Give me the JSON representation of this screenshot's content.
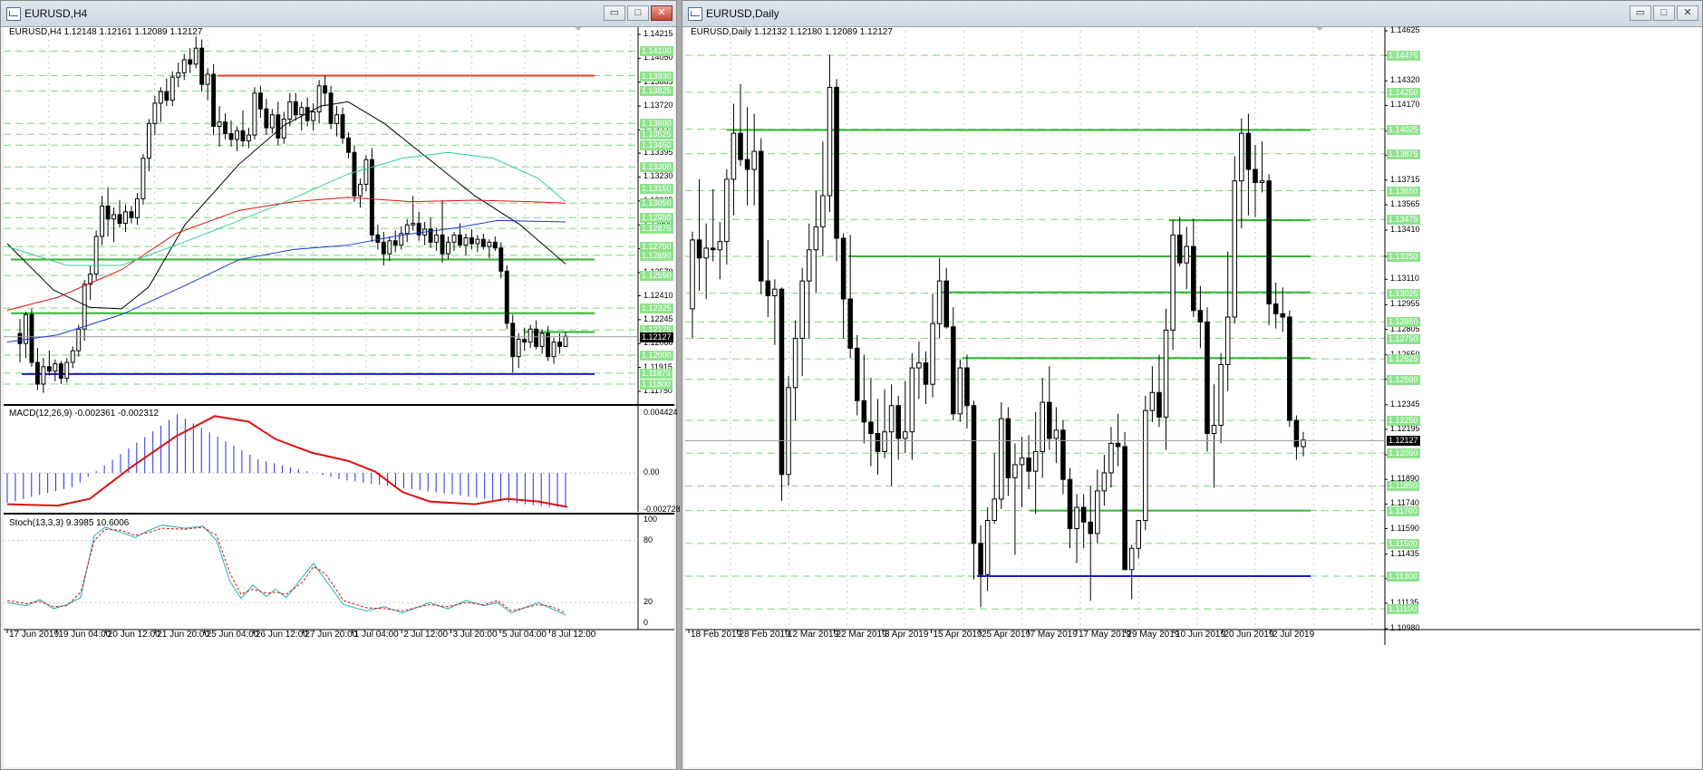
{
  "colors": {
    "bull": "#ffffff",
    "bear": "#000000",
    "support_green": "#2fb52f",
    "resistance_red": "#e8401e",
    "blue_line": "#1a1ad0",
    "grid": "#7ed67e",
    "macd_hist": "#2a2ae0",
    "macd_signal": "#e01010",
    "stoch_main": "#20b0c0",
    "stoch_signal": "#e01010",
    "badge": "#8fe38f",
    "ma_black": "#000000",
    "ma_red": "#e01010",
    "ma_blue": "#1a3ad0",
    "ma_cyan": "#30d090"
  },
  "left": {
    "title": "EURUSD,H4",
    "ohlc": "EURUSD,H4  1.12148 1.12161 1.12089 1.12127",
    "macd_label": "MACD(12,26,9) -0.002361 -0.002312",
    "stoch_label": "Stoch(13,3,3) 9.3985 10.6006",
    "price_ticks": [
      "1.14215",
      "1.14050",
      "1.13885",
      "1.13720",
      "1.13555",
      "1.13395",
      "1.13230",
      "1.13065",
      "1.12900",
      "1.12735",
      "1.12570",
      "1.12410",
      "1.12245",
      "1.12080",
      "1.11915",
      "1.11750"
    ],
    "price_badges": [
      "1.14100",
      "1.13930",
      "1.13825",
      "1.13600",
      "1.13525",
      "1.13450",
      "1.13300",
      "1.13150",
      "1.13050",
      "1.12950",
      "1.12875",
      "1.12750",
      "1.12690",
      "1.12550",
      "1.12325",
      "1.12175",
      "1.12000",
      "1.11875",
      "1.11800"
    ],
    "current_price": "1.12127",
    "macd_ticks": [
      "0.004424",
      "0.00",
      "-0.002728"
    ],
    "stoch_ticks": [
      "100",
      "80",
      "20",
      "0"
    ],
    "date_ticks": [
      "17 Jun 2019",
      "19 Jun 04:00",
      "20 Jun 12:00",
      "21 Jun 20:00",
      "25 Jun 04:00",
      "26 Jun 12:00",
      "27 Jun 20:00",
      "1 Jul 04:00",
      "2 Jul 12:00",
      "3 Jul 20:00",
      "5 Jul 04:00",
      "8 Jul 12:00"
    ],
    "candles": [
      [
        1.1215,
        1.1225,
        1.1195,
        1.1208
      ],
      [
        1.1208,
        1.123,
        1.1198,
        1.1228
      ],
      [
        1.1228,
        1.1232,
        1.1192,
        1.1195
      ],
      [
        1.1195,
        1.1205,
        1.1176,
        1.118
      ],
      [
        1.118,
        1.1198,
        1.1174,
        1.1192
      ],
      [
        1.1192,
        1.1203,
        1.1186,
        1.1189
      ],
      [
        1.1189,
        1.1197,
        1.1182,
        1.1194
      ],
      [
        1.1194,
        1.1196,
        1.118,
        1.1184
      ],
      [
        1.1184,
        1.1198,
        1.1181,
        1.1195
      ],
      [
        1.1195,
        1.1206,
        1.1191,
        1.1203
      ],
      [
        1.1203,
        1.1221,
        1.1199,
        1.1218
      ],
      [
        1.1218,
        1.1252,
        1.121,
        1.1249
      ],
      [
        1.1249,
        1.1262,
        1.1238,
        1.1256
      ],
      [
        1.1256,
        1.1286,
        1.1252,
        1.1282
      ],
      [
        1.1282,
        1.131,
        1.1276,
        1.1303
      ],
      [
        1.1303,
        1.1316,
        1.1282,
        1.1294
      ],
      [
        1.1294,
        1.1302,
        1.1278,
        1.1297
      ],
      [
        1.1297,
        1.1307,
        1.1288,
        1.1291
      ],
      [
        1.1291,
        1.1304,
        1.1285,
        1.1299
      ],
      [
        1.1299,
        1.1303,
        1.1291,
        1.1295
      ],
      [
        1.1295,
        1.1312,
        1.129,
        1.1308
      ],
      [
        1.1308,
        1.1339,
        1.1304,
        1.1336
      ],
      [
        1.1336,
        1.1363,
        1.1327,
        1.136
      ],
      [
        1.136,
        1.1379,
        1.1352,
        1.1374
      ],
      [
        1.1374,
        1.1385,
        1.1361,
        1.1382
      ],
      [
        1.1382,
        1.1391,
        1.1372,
        1.1376
      ],
      [
        1.1376,
        1.1396,
        1.1372,
        1.1392
      ],
      [
        1.1392,
        1.1402,
        1.1385,
        1.1395
      ],
      [
        1.1395,
        1.1408,
        1.139,
        1.1404
      ],
      [
        1.1404,
        1.1412,
        1.1395,
        1.1401
      ],
      [
        1.1401,
        1.142,
        1.1398,
        1.1412
      ],
      [
        1.1412,
        1.1418,
        1.1382,
        1.1387
      ],
      [
        1.1387,
        1.1398,
        1.1376,
        1.1394
      ],
      [
        1.1394,
        1.1401,
        1.1352,
        1.1358
      ],
      [
        1.1358,
        1.1372,
        1.1344,
        1.1361
      ],
      [
        1.1361,
        1.1367,
        1.1349,
        1.1353
      ],
      [
        1.1353,
        1.1362,
        1.1344,
        1.1349
      ],
      [
        1.1349,
        1.1358,
        1.1341,
        1.1355
      ],
      [
        1.1355,
        1.1369,
        1.1344,
        1.1348
      ],
      [
        1.1348,
        1.1357,
        1.1343,
        1.1352
      ],
      [
        1.1352,
        1.1385,
        1.1349,
        1.1381
      ],
      [
        1.1381,
        1.1386,
        1.1364,
        1.137
      ],
      [
        1.137,
        1.1377,
        1.1352,
        1.1357
      ],
      [
        1.1357,
        1.137,
        1.1353,
        1.1366
      ],
      [
        1.1366,
        1.1375,
        1.1345,
        1.135
      ],
      [
        1.135,
        1.1368,
        1.1346,
        1.1363
      ],
      [
        1.1363,
        1.1381,
        1.1358,
        1.1375
      ],
      [
        1.1375,
        1.1381,
        1.1362,
        1.1366
      ],
      [
        1.1366,
        1.1375,
        1.1355,
        1.1371
      ],
      [
        1.1371,
        1.1378,
        1.1358,
        1.1362
      ],
      [
        1.1362,
        1.1374,
        1.1355,
        1.1368
      ],
      [
        1.1368,
        1.139,
        1.136,
        1.1386
      ],
      [
        1.1386,
        1.1393,
        1.1372,
        1.1381
      ],
      [
        1.1381,
        1.1386,
        1.1356,
        1.136
      ],
      [
        1.136,
        1.1372,
        1.1351,
        1.1366
      ],
      [
        1.1366,
        1.1371,
        1.1346,
        1.135
      ],
      [
        1.135,
        1.1354,
        1.1336,
        1.134
      ],
      [
        1.134,
        1.1345,
        1.1306,
        1.131
      ],
      [
        1.131,
        1.1322,
        1.1302,
        1.1318
      ],
      [
        1.1318,
        1.1338,
        1.1313,
        1.1335
      ],
      [
        1.1335,
        1.1343,
        1.1278,
        1.1283
      ],
      [
        1.1283,
        1.129,
        1.1273,
        1.1278
      ],
      [
        1.1278,
        1.1285,
        1.1262,
        1.127
      ],
      [
        1.127,
        1.1282,
        1.1265,
        1.1279
      ],
      [
        1.1279,
        1.1286,
        1.1271,
        1.1276
      ],
      [
        1.1276,
        1.1289,
        1.1273,
        1.1284
      ],
      [
        1.1284,
        1.1294,
        1.1278,
        1.129
      ],
      [
        1.129,
        1.131,
        1.1286,
        1.1291
      ],
      [
        1.1291,
        1.1299,
        1.1279,
        1.1283
      ],
      [
        1.1283,
        1.1292,
        1.1276,
        1.1287
      ],
      [
        1.1287,
        1.1295,
        1.1274,
        1.1278
      ],
      [
        1.1278,
        1.1288,
        1.1272,
        1.1283
      ],
      [
        1.1283,
        1.1307,
        1.1264,
        1.127
      ],
      [
        1.127,
        1.1282,
        1.1266,
        1.1278
      ],
      [
        1.1278,
        1.1285,
        1.1272,
        1.1283
      ],
      [
        1.1283,
        1.1291,
        1.1274,
        1.1276
      ],
      [
        1.1276,
        1.1284,
        1.1269,
        1.1281
      ],
      [
        1.1281,
        1.1287,
        1.1273,
        1.1277
      ],
      [
        1.1277,
        1.1283,
        1.1271,
        1.128
      ],
      [
        1.128,
        1.1284,
        1.1273,
        1.1275
      ],
      [
        1.1275,
        1.128,
        1.1267,
        1.1278
      ],
      [
        1.1278,
        1.1282,
        1.1272,
        1.1274
      ],
      [
        1.1274,
        1.1278,
        1.1253,
        1.1258
      ],
      [
        1.1258,
        1.1262,
        1.1218,
        1.1222
      ],
      [
        1.1222,
        1.1228,
        1.1188,
        1.1199
      ],
      [
        1.1199,
        1.1215,
        1.1191,
        1.1211
      ],
      [
        1.1211,
        1.1219,
        1.1203,
        1.1209
      ],
      [
        1.1209,
        1.1221,
        1.1205,
        1.1218
      ],
      [
        1.1218,
        1.1224,
        1.1204,
        1.1206
      ],
      [
        1.1206,
        1.1218,
        1.1201,
        1.1215
      ],
      [
        1.1215,
        1.122,
        1.1196,
        1.1199
      ],
      [
        1.1199,
        1.1212,
        1.1194,
        1.1209
      ],
      [
        1.1209,
        1.1215,
        1.1201,
        1.1206
      ],
      [
        1.1206,
        1.1216,
        1.1208,
        1.1213
      ]
    ],
    "lines": [
      {
        "price": 1.1393,
        "color": "red"
      },
      {
        "price": 1.1266,
        "color": "green"
      },
      {
        "price": 1.1229,
        "color": "green"
      },
      {
        "price": 1.1216,
        "color": "green"
      },
      {
        "price": 1.1187,
        "color": "blue"
      }
    ]
  },
  "right": {
    "title": "EURUSD,Daily",
    "ohlc": "EURUSD,Daily  1.12132 1.12180 1.12089 1.12127",
    "price_ticks": [
      "1.14625",
      "1.14475",
      "1.14320",
      "1.14170",
      "1.14015",
      "1.13865",
      "1.13715",
      "1.13565",
      "1.13410",
      "1.13250",
      "1.13110",
      "1.12955",
      "1.12805",
      "1.12650",
      "1.12500",
      "1.12345",
      "1.12195",
      "1.12040",
      "1.11890",
      "1.11740",
      "1.11590",
      "1.11435",
      "1.11285",
      "1.11135",
      "1.10980"
    ],
    "price_badges": [
      "1.14475",
      "1.14250",
      "1.14025",
      "1.13875",
      "1.13650",
      "1.13475",
      "1.13250",
      "1.13025",
      "1.12850",
      "1.12750",
      "1.12625",
      "1.12500",
      "1.12250",
      "1.12050",
      "1.11850",
      "1.11700",
      "1.11500",
      "1.11300",
      "1.11100"
    ],
    "current_price": "1.12127",
    "date_ticks": [
      "18 Feb 2019",
      "28 Feb 2019",
      "12 Mar 2019",
      "22 Mar 2019",
      "3 Apr 2019",
      "15 Apr 2019",
      "25 Apr 2019",
      "7 May 2019",
      "17 May 2019",
      "29 May 2019",
      "10 Jun 2019",
      "20 Jun 2019",
      "2 Jul 2019"
    ],
    "candles": [
      [
        1.1293,
        1.134,
        1.1275,
        1.1335
      ],
      [
        1.1335,
        1.1372,
        1.1304,
        1.1324
      ],
      [
        1.1324,
        1.1345,
        1.1299,
        1.133
      ],
      [
        1.133,
        1.1366,
        1.1322,
        1.1329
      ],
      [
        1.1329,
        1.1346,
        1.1311,
        1.1334
      ],
      [
        1.1334,
        1.1378,
        1.132,
        1.1372
      ],
      [
        1.1372,
        1.1418,
        1.135,
        1.14
      ],
      [
        1.14,
        1.143,
        1.138,
        1.1384
      ],
      [
        1.1384,
        1.1416,
        1.1356,
        1.1378
      ],
      [
        1.1378,
        1.1412,
        1.1356,
        1.1389
      ],
      [
        1.1389,
        1.1397,
        1.1302,
        1.131
      ],
      [
        1.131,
        1.1335,
        1.1288,
        1.1301
      ],
      [
        1.1301,
        1.1311,
        1.1271,
        1.1305
      ],
      [
        1.1305,
        1.1306,
        1.1176,
        1.1192
      ],
      [
        1.1192,
        1.1252,
        1.1185,
        1.1245
      ],
      [
        1.1245,
        1.1286,
        1.1225,
        1.1275
      ],
      [
        1.1275,
        1.1318,
        1.1252,
        1.131
      ],
      [
        1.131,
        1.1345,
        1.1275,
        1.1329
      ],
      [
        1.1329,
        1.1365,
        1.1303,
        1.1343
      ],
      [
        1.1343,
        1.1395,
        1.1325,
        1.1362
      ],
      [
        1.1362,
        1.1448,
        1.1352,
        1.1428
      ],
      [
        1.1428,
        1.1433,
        1.1322,
        1.1336
      ],
      [
        1.1336,
        1.1339,
        1.1275,
        1.1299
      ],
      [
        1.1299,
        1.1338,
        1.1263,
        1.1269
      ],
      [
        1.1269,
        1.1277,
        1.1228,
        1.1237
      ],
      [
        1.1237,
        1.1265,
        1.1211,
        1.1224
      ],
      [
        1.1224,
        1.1251,
        1.1197,
        1.1217
      ],
      [
        1.1217,
        1.1238,
        1.1192,
        1.1206
      ],
      [
        1.1206,
        1.1244,
        1.1202,
        1.1218
      ],
      [
        1.1218,
        1.1247,
        1.1185,
        1.1234
      ],
      [
        1.1234,
        1.124,
        1.1201,
        1.1214
      ],
      [
        1.1214,
        1.1249,
        1.1205,
        1.1218
      ],
      [
        1.1218,
        1.1266,
        1.1201,
        1.1257
      ],
      [
        1.1257,
        1.1273,
        1.1238,
        1.126
      ],
      [
        1.126,
        1.1267,
        1.1235,
        1.1247
      ],
      [
        1.1247,
        1.1302,
        1.1239,
        1.1284
      ],
      [
        1.1284,
        1.1324,
        1.1275,
        1.131
      ],
      [
        1.131,
        1.1318,
        1.1281,
        1.1282
      ],
      [
        1.1282,
        1.1294,
        1.1225,
        1.1229
      ],
      [
        1.1229,
        1.1262,
        1.1224,
        1.1257
      ],
      [
        1.1257,
        1.1265,
        1.122,
        1.1234
      ],
      [
        1.1234,
        1.1237,
        1.1128,
        1.115
      ],
      [
        1.115,
        1.1161,
        1.1111,
        1.1131
      ],
      [
        1.1131,
        1.1172,
        1.1121,
        1.1164
      ],
      [
        1.1164,
        1.1205,
        1.1162,
        1.1177
      ],
      [
        1.1177,
        1.1236,
        1.1171,
        1.1226
      ],
      [
        1.1226,
        1.1233,
        1.1179,
        1.119
      ],
      [
        1.119,
        1.1211,
        1.1143,
        1.1198
      ],
      [
        1.1198,
        1.1215,
        1.1172,
        1.1202
      ],
      [
        1.1202,
        1.1216,
        1.1183,
        1.1194
      ],
      [
        1.1194,
        1.123,
        1.1168,
        1.1206
      ],
      [
        1.1206,
        1.1251,
        1.119,
        1.1236
      ],
      [
        1.1236,
        1.1258,
        1.1207,
        1.1214
      ],
      [
        1.1214,
        1.1233,
        1.1199,
        1.1219
      ],
      [
        1.1219,
        1.1225,
        1.118,
        1.1189
      ],
      [
        1.1189,
        1.1196,
        1.1147,
        1.1159
      ],
      [
        1.1159,
        1.118,
        1.1138,
        1.1172
      ],
      [
        1.1172,
        1.118,
        1.1147,
        1.1163
      ],
      [
        1.1163,
        1.1185,
        1.1115,
        1.1156
      ],
      [
        1.1156,
        1.1195,
        1.115,
        1.1182
      ],
      [
        1.1182,
        1.1204,
        1.1173,
        1.1193
      ],
      [
        1.1193,
        1.1221,
        1.1184,
        1.1211
      ],
      [
        1.1211,
        1.1229,
        1.1197,
        1.1209
      ],
      [
        1.1209,
        1.1218,
        1.1141,
        1.1134
      ],
      [
        1.1134,
        1.1149,
        1.1116,
        1.1147
      ],
      [
        1.1147,
        1.1163,
        1.1141,
        1.1164
      ],
      [
        1.1164,
        1.124,
        1.1158,
        1.1231
      ],
      [
        1.1231,
        1.1258,
        1.1224,
        1.1242
      ],
      [
        1.1242,
        1.1265,
        1.1221,
        1.1227
      ],
      [
        1.1227,
        1.1293,
        1.1207,
        1.128
      ],
      [
        1.128,
        1.1347,
        1.1268,
        1.1338
      ],
      [
        1.1338,
        1.1349,
        1.1319,
        1.1321
      ],
      [
        1.1321,
        1.1343,
        1.1305,
        1.1331
      ],
      [
        1.1331,
        1.1348,
        1.1288,
        1.1292
      ],
      [
        1.1292,
        1.1307,
        1.1269,
        1.1285
      ],
      [
        1.1285,
        1.1294,
        1.1206,
        1.1217
      ],
      [
        1.1217,
        1.1247,
        1.1184,
        1.1222
      ],
      [
        1.1222,
        1.1266,
        1.1211,
        1.1259
      ],
      [
        1.1259,
        1.1328,
        1.1243,
        1.1288
      ],
      [
        1.1288,
        1.1386,
        1.1284,
        1.1371
      ],
      [
        1.1371,
        1.1409,
        1.1342,
        1.14
      ],
      [
        1.14,
        1.1412,
        1.135,
        1.1378
      ],
      [
        1.1378,
        1.1393,
        1.1349,
        1.137
      ],
      [
        1.137,
        1.1395,
        1.1364,
        1.1371
      ],
      [
        1.1371,
        1.1375,
        1.1283,
        1.1296
      ],
      [
        1.1296,
        1.1309,
        1.1281,
        1.129
      ],
      [
        1.129,
        1.1306,
        1.1279,
        1.1288
      ],
      [
        1.1288,
        1.1292,
        1.1221,
        1.1225
      ],
      [
        1.1225,
        1.1228,
        1.1201,
        1.1209
      ],
      [
        1.1209,
        1.1218,
        1.1203,
        1.1213
      ]
    ],
    "lines": [
      {
        "price": 1.1402,
        "color": "green"
      },
      {
        "price": 1.1347,
        "color": "green"
      },
      {
        "price": 1.1325,
        "color": "green"
      },
      {
        "price": 1.1303,
        "color": "green"
      },
      {
        "price": 1.1263,
        "color": "green"
      },
      {
        "price": 1.117,
        "color": "green"
      },
      {
        "price": 1.113,
        "color": "blue"
      }
    ]
  }
}
